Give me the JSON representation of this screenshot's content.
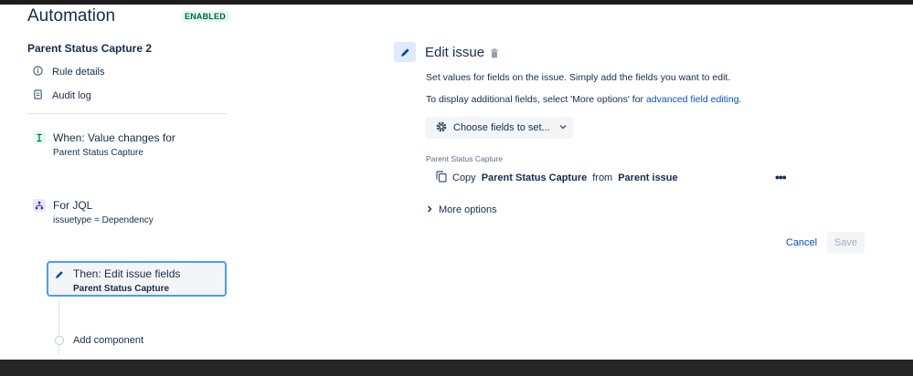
{
  "header": {
    "title": "Automation",
    "status": "ENABLED"
  },
  "sidebar": {
    "rule_name": "Parent Status Capture 2",
    "links": [
      {
        "label": "Rule details",
        "icon": "info-icon"
      },
      {
        "label": "Audit log",
        "icon": "document-icon"
      }
    ],
    "trigger": {
      "title": "When: Value changes for",
      "subtitle": "Parent Status Capture",
      "icon": "trigger-icon"
    },
    "branch": {
      "title": "For JQL",
      "subtitle": "issuetype = Dependency",
      "icon": "branch-icon"
    },
    "action": {
      "title": "Then: Edit issue fields",
      "subtitle": "Parent Status Capture",
      "icon": "pencil-icon"
    },
    "add_component": "Add component"
  },
  "panel": {
    "title": "Edit issue",
    "description_1": "Set values for fields on the issue. Simply add the fields you want to edit.",
    "description_2_prefix": "To display additional fields, select 'More options' for ",
    "description_2_link": "advanced field editing",
    "description_2_suffix": ".",
    "choose_fields_label": "Choose fields to set...",
    "field_label": "Parent Status Capture",
    "copy_row": {
      "verb": "Copy",
      "field": "Parent Status Capture",
      "from_word": "from",
      "source": "Parent issue"
    },
    "more_options_label": "More options",
    "cancel_label": "Cancel",
    "save_label": "Save"
  },
  "colors": {
    "text": "#172b4d",
    "link": "#0052cc",
    "enabled_bg": "#e3fcef",
    "enabled_text": "#006644",
    "trigger_icon_bg": "#e3fcef",
    "branch_icon_bg": "#eae6ff",
    "action_border": "#4c9aff",
    "action_icon_bg": "#deebff"
  }
}
